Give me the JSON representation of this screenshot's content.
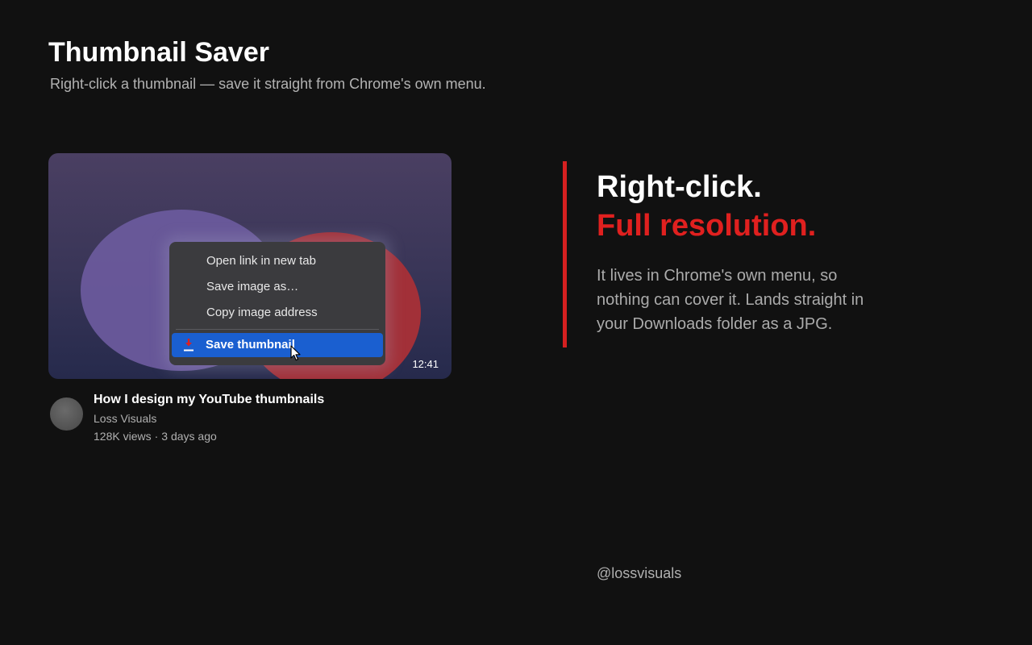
{
  "header": {
    "title": "Thumbnail Saver",
    "subtitle": "Right-click a thumbnail — save it straight from Chrome's own menu."
  },
  "thumbnail": {
    "duration": "12:41"
  },
  "context_menu": {
    "items": [
      {
        "label": "Open link in new tab"
      },
      {
        "label": "Save image as…"
      },
      {
        "label": "Copy image address"
      }
    ],
    "selected": {
      "label": "Save thumbnail",
      "icon": "download-icon"
    }
  },
  "video": {
    "title": "How I design my YouTube thumbnails",
    "channel": "Loss Visuals",
    "views": "128K views",
    "separator": "·",
    "age": "3 days ago"
  },
  "promo": {
    "headline_1": "Right-click.",
    "headline_2": "Full resolution.",
    "body": "It lives in Chrome's own menu, so nothing can cover it. Lands straight in your Downloads folder as a JPG.",
    "handle": "@lossvisuals"
  },
  "colors": {
    "background": "#111111",
    "accent_red": "#e0201f",
    "menu_selected": "#1a5fd0"
  }
}
